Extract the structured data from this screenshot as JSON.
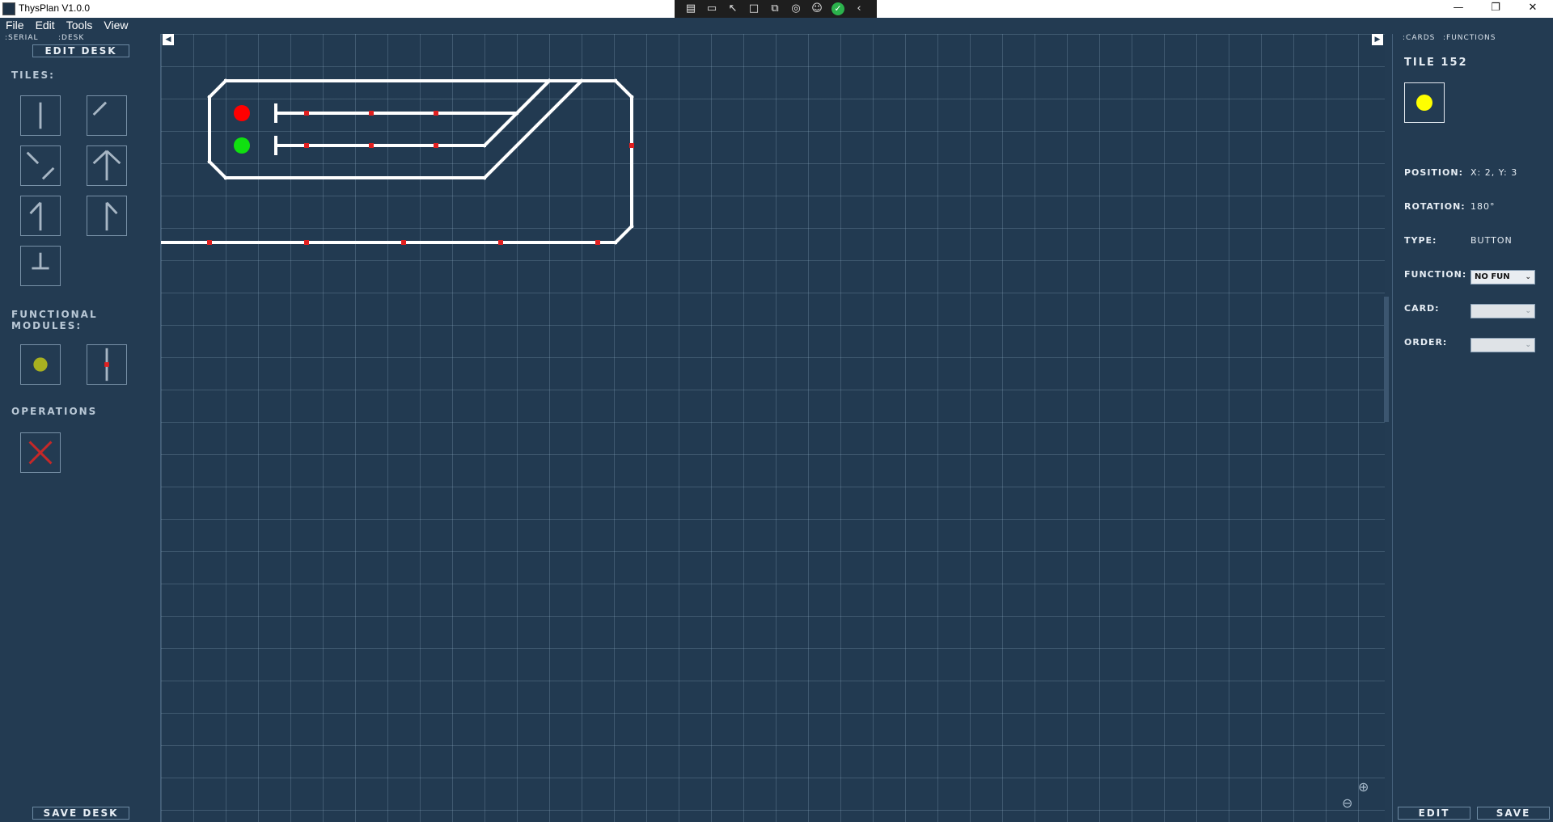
{
  "window": {
    "title": "ThysPlan V1.0.0",
    "controls": {
      "minimize": "—",
      "restore": "❐",
      "close": "✕"
    }
  },
  "toolbar_icons": [
    "screen-icon",
    "camera-icon",
    "cursor-icon",
    "frame-icon",
    "window-icon",
    "broadcast-icon",
    "accessibility-icon",
    "check-icon",
    "collapse-icon"
  ],
  "menu": [
    "File",
    "Edit",
    "Tools",
    "View"
  ],
  "left": {
    "tabs": [
      ":SERIAL",
      ":DESK"
    ],
    "edit_desk": "EDIT DESK",
    "tiles_label": "TILES:",
    "functional_label_1": "FUNCTIONAL",
    "functional_label_2": "MODULES:",
    "operations_label": "OPERATIONS",
    "save_desk": "SAVE DESK"
  },
  "right": {
    "tabs": [
      ":CARDS",
      ":FUNCTIONS"
    ],
    "tile_title": "TILE 152",
    "position_label": "POSITION:",
    "position_value": "X: 2, Y: 3",
    "rotation_label": "ROTATION:",
    "rotation_value": "180°",
    "type_label": "TYPE:",
    "type_value": "BUTTON",
    "function_label": "FUNCTION:",
    "function_value": "NO FUN",
    "card_label": "CARD:",
    "card_value": "",
    "order_label": "ORDER:",
    "order_value": "",
    "edit_btn": "EDIT",
    "save_btn": "SAVE"
  },
  "colors": {
    "background": "#233b52",
    "track": "#ffffff",
    "sensor": "#e02020",
    "signal_red": "#ff0000",
    "signal_green": "#10e010",
    "module_yellow": "#a8b020",
    "selected_yellow": "#ffff00"
  }
}
